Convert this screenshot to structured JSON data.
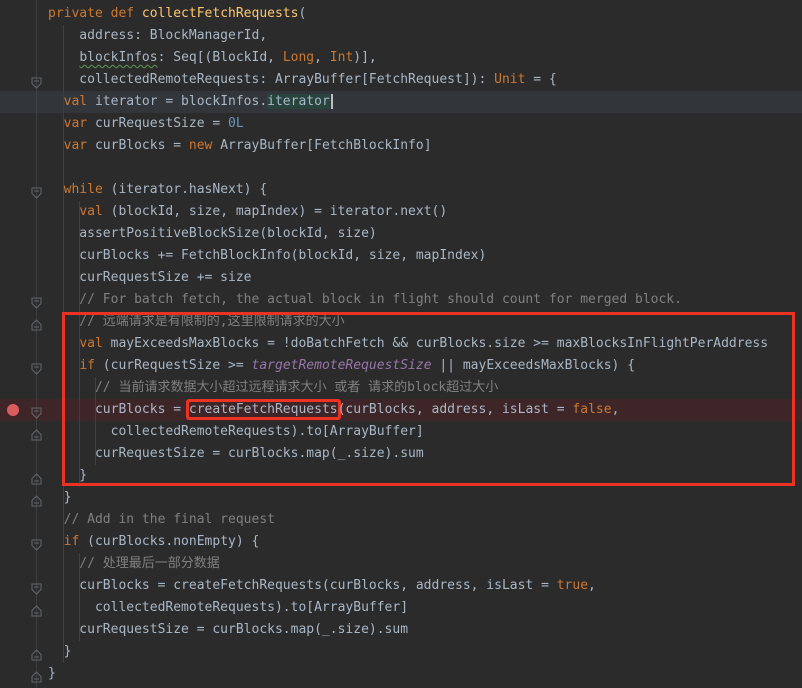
{
  "app": {
    "type": "code-editor",
    "theme": "darcula"
  },
  "palette": {
    "bg": "#2b2b2b",
    "gutter_bg": "#2d2d2d",
    "keyword": "#cc7832",
    "func": "#ffc66d",
    "plain": "#a9b7c6",
    "number": "#6897bb",
    "comment": "#808080",
    "field": "#9876aa",
    "green_hl": "#29443c",
    "caret_line": "#32363a",
    "bp_line": "#3e2628",
    "annot": "#ec3323",
    "bp_dot": "#db5c5c",
    "guide": "#3d3f41",
    "connector": "#4b4e50",
    "marker": "#63676b",
    "caret": "#bcbec4"
  },
  "annotations": {
    "large_box_color": "#ec3323",
    "boxed_token": "createFetchRequests",
    "breakpoint_line_text": "curBlocks = createFetchRequests(curBlocks, address, isLast = false,"
  },
  "editor": {
    "lines": [
      {
        "segs": [
          [
            "private def ",
            "k"
          ],
          [
            "collectFetchRequests",
            "f"
          ],
          [
            "(",
            "d"
          ]
        ]
      },
      {
        "segs": [
          [
            "    address: BlockManagerId,",
            "d"
          ]
        ]
      },
      {
        "segs": [
          [
            "    ",
            "d"
          ],
          [
            "blockInfos",
            "w"
          ],
          [
            ": Seq[(BlockId, ",
            "d"
          ],
          [
            "Long",
            "k"
          ],
          [
            ", ",
            "d"
          ],
          [
            "Int",
            "k"
          ],
          [
            ")],",
            "d"
          ]
        ]
      },
      {
        "fold": "down",
        "segs": [
          [
            "    collectedRemoteRequests: ArrayBuffer[FetchRequest]): ",
            "d"
          ],
          [
            "Unit",
            "k"
          ],
          [
            " = {",
            "d"
          ]
        ]
      },
      {
        "bg": "caret",
        "caret": true,
        "segs": [
          [
            "  ",
            "d"
          ],
          [
            "val ",
            "k"
          ],
          [
            "iterator = blockInfos.",
            "d"
          ],
          [
            "iterator",
            "g"
          ]
        ]
      },
      {
        "segs": [
          [
            "  ",
            "d"
          ],
          [
            "var ",
            "k"
          ],
          [
            "curRequestSize = ",
            "d"
          ],
          [
            "0L",
            "n"
          ]
        ]
      },
      {
        "segs": [
          [
            "  ",
            "d"
          ],
          [
            "var ",
            "k"
          ],
          [
            "curBlocks = ",
            "d"
          ],
          [
            "new",
            "k"
          ],
          [
            " ArrayBuffer[FetchBlockInfo]",
            "d"
          ]
        ]
      },
      {
        "segs": []
      },
      {
        "fold": "down",
        "segs": [
          [
            "  ",
            "d"
          ],
          [
            "while",
            "k"
          ],
          [
            " (iterator.hasNext) {",
            "d"
          ]
        ]
      },
      {
        "segs": [
          [
            "    ",
            "d"
          ],
          [
            "val",
            "k"
          ],
          [
            " (blockId, size, mapIndex) = iterator.next()",
            "d"
          ]
        ]
      },
      {
        "segs": [
          [
            "    assertPositiveBlockSize(blockId, size)",
            "d"
          ]
        ]
      },
      {
        "segs": [
          [
            "    curBlocks += FetchBlockInfo(blockId, size, mapIndex)",
            "d"
          ]
        ]
      },
      {
        "segs": [
          [
            "    curRequestSize += size",
            "d"
          ]
        ]
      },
      {
        "fold": "down",
        "segs": [
          [
            "    // For batch fetch, the actual block in flight should count for merged block.",
            "c"
          ]
        ]
      },
      {
        "fold": "up",
        "segs": [
          [
            "    // 远端请求是有限制的,这里限制请求的大小",
            "c"
          ]
        ]
      },
      {
        "segs": [
          [
            "    ",
            "d"
          ],
          [
            "val",
            "k"
          ],
          [
            " mayExceedsMaxBlocks = !doBatchFetch && curBlocks.size >= maxBlocksInFlightPerAddress",
            "d"
          ]
        ]
      },
      {
        "fold": "down",
        "segs": [
          [
            "    ",
            "d"
          ],
          [
            "if",
            "k"
          ],
          [
            " (curRequestSize >= ",
            "d"
          ],
          [
            "targetRemoteRequestSize",
            "p"
          ],
          [
            " || mayExceedsMaxBlocks) {",
            "d"
          ]
        ]
      },
      {
        "segs": [
          [
            "      // 当前请求数据大小超过远程请求大小 或者 请求的block超过大小",
            "c"
          ]
        ]
      },
      {
        "bg": "bp",
        "breakpoint": true,
        "fold": "down",
        "segs": [
          [
            "      curBlocks = ",
            "d"
          ],
          [
            "createFetchRequests",
            "b"
          ],
          [
            "(curBlocks, address, isLast = ",
            "d"
          ],
          [
            "false",
            "k"
          ],
          [
            ",",
            "d"
          ]
        ]
      },
      {
        "fold": "up",
        "segs": [
          [
            "        collectedRemoteRequests).to[ArrayBuffer]",
            "d"
          ]
        ]
      },
      {
        "segs": [
          [
            "      curRequestSize = curBlocks.map(_.size).sum",
            "d"
          ]
        ]
      },
      {
        "fold": "up",
        "segs": [
          [
            "    }",
            "d"
          ]
        ]
      },
      {
        "fold": "up",
        "segs": [
          [
            "  }",
            "d"
          ]
        ]
      },
      {
        "segs": [
          [
            "  // Add in the final request",
            "c"
          ]
        ]
      },
      {
        "fold": "down",
        "segs": [
          [
            "  ",
            "d"
          ],
          [
            "if",
            "k"
          ],
          [
            " (curBlocks.nonEmpty) {",
            "d"
          ]
        ]
      },
      {
        "segs": [
          [
            "    // 处理最后一部分数据",
            "c"
          ]
        ]
      },
      {
        "fold": "down",
        "segs": [
          [
            "    curBlocks = createFetchRequests(curBlocks, address, isLast = ",
            "d"
          ],
          [
            "true",
            "k"
          ],
          [
            ",",
            "d"
          ]
        ]
      },
      {
        "fold": "up",
        "segs": [
          [
            "      collectedRemoteRequests).to[ArrayBuffer]",
            "d"
          ]
        ]
      },
      {
        "segs": [
          [
            "    curRequestSize = curBlocks.map(_.size).sum",
            "d"
          ]
        ]
      },
      {
        "fold": "up",
        "segs": [
          [
            "  }",
            "d"
          ]
        ]
      },
      {
        "fold": "up",
        "segs": [
          [
            "}",
            "d"
          ]
        ]
      }
    ]
  }
}
